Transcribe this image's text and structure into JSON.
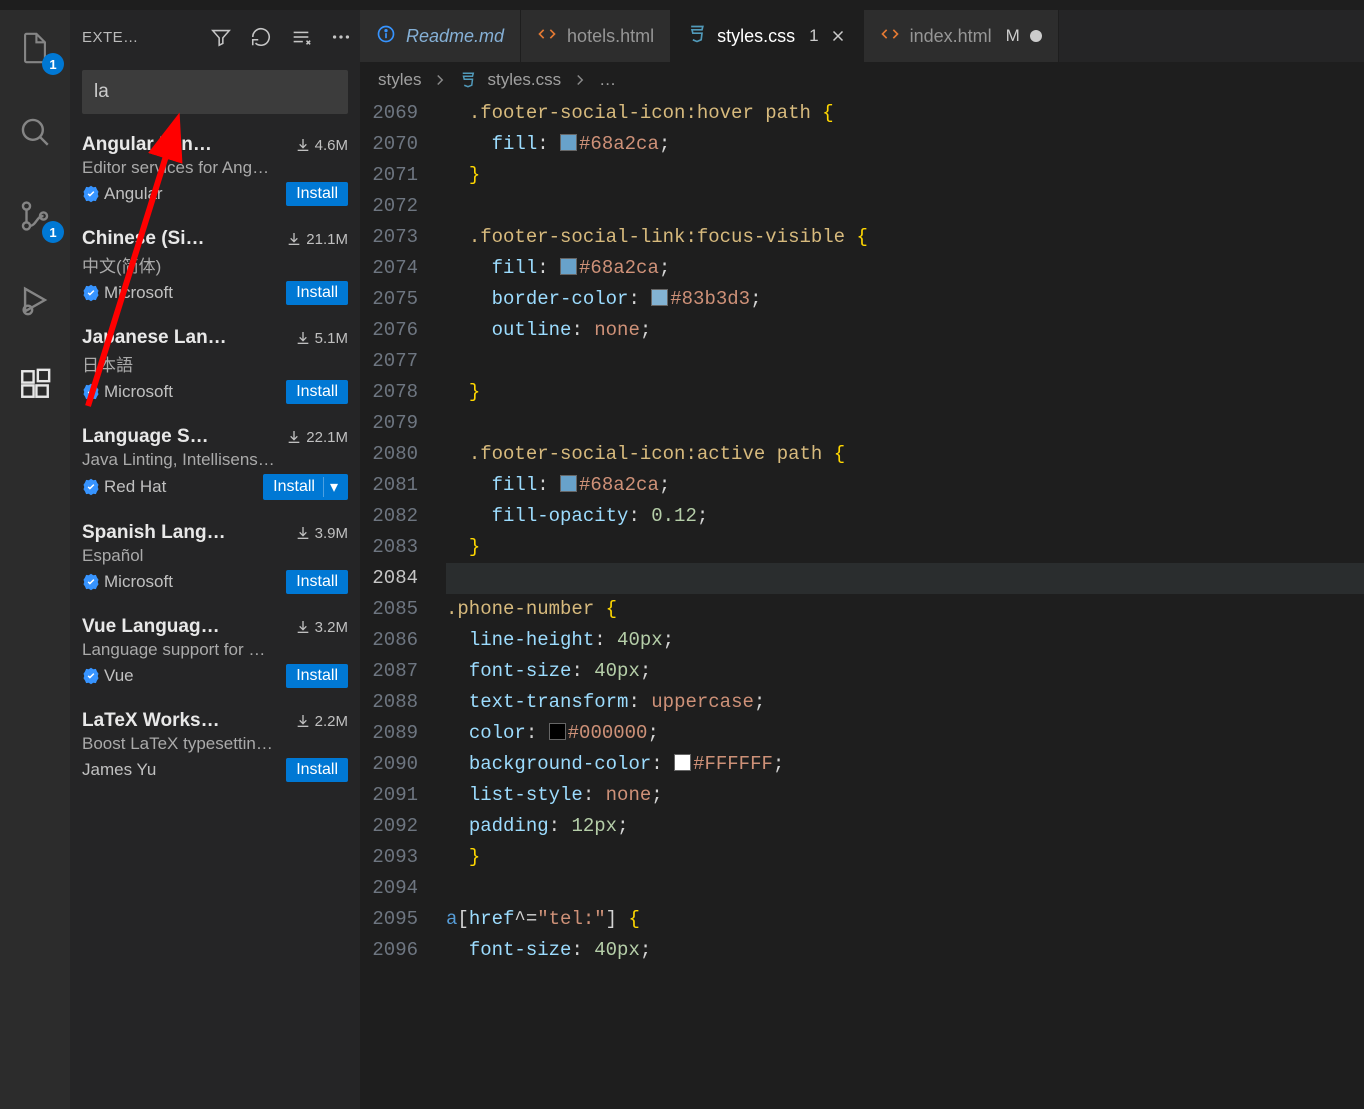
{
  "activity": {
    "explorerBadge": "1",
    "scmBadge": "1"
  },
  "sidebar": {
    "title": "EXTE…",
    "searchValue": "la",
    "items": [
      {
        "name": "Angular Lan…",
        "downloads": "4.6M",
        "desc": "Editor services for Ang…",
        "publisher": "Angular",
        "install": "Install",
        "verified": true,
        "hasDropdown": false
      },
      {
        "name": "Chinese (Si…",
        "downloads": "21.1M",
        "desc": "中文(简体)",
        "publisher": "Microsoft",
        "install": "Install",
        "verified": true,
        "hasDropdown": false
      },
      {
        "name": "Japanese Lan…",
        "downloads": "5.1M",
        "desc": "日本語",
        "publisher": "Microsoft",
        "install": "Install",
        "verified": true,
        "hasDropdown": false
      },
      {
        "name": "Language S…",
        "downloads": "22.1M",
        "desc": "Java Linting, Intellisens…",
        "publisher": "Red Hat",
        "install": "Install",
        "verified": true,
        "hasDropdown": true
      },
      {
        "name": "Spanish Lang…",
        "downloads": "3.9M",
        "desc": "Español",
        "publisher": "Microsoft",
        "install": "Install",
        "verified": true,
        "hasDropdown": false
      },
      {
        "name": "Vue Languag…",
        "downloads": "3.2M",
        "desc": "Language support for …",
        "publisher": "Vue",
        "install": "Install",
        "verified": true,
        "hasDropdown": false
      },
      {
        "name": "LaTeX Works…",
        "downloads": "2.2M",
        "desc": "Boost LaTeX typesettin…",
        "publisher": "James Yu",
        "install": "Install",
        "verified": false,
        "hasDropdown": false
      }
    ]
  },
  "tabs": [
    {
      "icon": "info",
      "filename": "Readme.md",
      "preview": true,
      "active": false,
      "status": "",
      "closable": false
    },
    {
      "icon": "html",
      "filename": "hotels.html",
      "preview": false,
      "active": false,
      "status": "",
      "closable": false
    },
    {
      "icon": "css",
      "filename": "styles.css",
      "preview": false,
      "active": true,
      "status": "1",
      "closable": true
    },
    {
      "icon": "html",
      "filename": "index.html",
      "preview": false,
      "active": false,
      "status": "M",
      "closable": false,
      "dot": true
    }
  ],
  "breadcrumb": {
    "folder": "styles",
    "file": "styles.css",
    "more": "…"
  },
  "code": {
    "currentLine": 2084,
    "lines": [
      {
        "n": 2069,
        "html": "  <span class='tok-selector'>.footer-social-icon</span><span class='tok-pseudo'>:hover</span> <span class='tok-selector'>path</span> <span class='tok-brace'>{</span>"
      },
      {
        "n": 2070,
        "html": "    <span class='tok-prop'>fill</span><span class='tok-punc'>:</span> <span class='swatch' style='background:#68a2ca'></span><span class='tok-val'>#68a2ca</span><span class='tok-punc'>;</span>"
      },
      {
        "n": 2071,
        "html": "  <span class='tok-brace'>}</span>"
      },
      {
        "n": 2072,
        "html": ""
      },
      {
        "n": 2073,
        "html": "  <span class='tok-selector'>.footer-social-link</span><span class='tok-pseudo'>:focus-visible</span> <span class='tok-brace'>{</span>"
      },
      {
        "n": 2074,
        "html": "    <span class='tok-prop'>fill</span><span class='tok-punc'>:</span> <span class='swatch' style='background:#68a2ca'></span><span class='tok-val'>#68a2ca</span><span class='tok-punc'>;</span>"
      },
      {
        "n": 2075,
        "html": "    <span class='tok-prop'>border-color</span><span class='tok-punc'>:</span> <span class='swatch' style='background:#83b3d3'></span><span class='tok-val'>#83b3d3</span><span class='tok-punc'>;</span>"
      },
      {
        "n": 2076,
        "html": "    <span class='tok-prop'>outline</span><span class='tok-punc'>:</span> <span class='tok-val'>none</span><span class='tok-punc'>;</span>"
      },
      {
        "n": 2077,
        "html": ""
      },
      {
        "n": 2078,
        "html": "  <span class='tok-brace'>}</span>"
      },
      {
        "n": 2079,
        "html": ""
      },
      {
        "n": 2080,
        "html": "  <span class='tok-selector'>.footer-social-icon</span><span class='tok-pseudo'>:active</span> <span class='tok-selector'>path</span> <span class='tok-brace'>{</span>"
      },
      {
        "n": 2081,
        "html": "    <span class='tok-prop'>fill</span><span class='tok-punc'>:</span> <span class='swatch' style='background:#68a2ca'></span><span class='tok-val'>#68a2ca</span><span class='tok-punc'>;</span>"
      },
      {
        "n": 2082,
        "html": "    <span class='tok-prop'>fill-opacity</span><span class='tok-punc'>:</span> <span class='tok-num'>0.12</span><span class='tok-punc'>;</span>"
      },
      {
        "n": 2083,
        "html": "  <span class='tok-brace'>}</span>"
      },
      {
        "n": 2084,
        "html": ""
      },
      {
        "n": 2085,
        "html": "<span class='tok-selector'>.phone-number</span> <span class='tok-brace'>{</span>"
      },
      {
        "n": 2086,
        "html": "  <span class='tok-prop'>line-height</span><span class='tok-punc'>:</span> <span class='tok-num'>40px</span><span class='tok-punc'>;</span>"
      },
      {
        "n": 2087,
        "html": "  <span class='tok-prop'>font-size</span><span class='tok-punc'>:</span> <span class='tok-num'>40px</span><span class='tok-punc'>;</span>"
      },
      {
        "n": 2088,
        "html": "  <span class='tok-prop'>text-transform</span><span class='tok-punc'>:</span> <span class='tok-val'>uppercase</span><span class='tok-punc'>;</span>"
      },
      {
        "n": 2089,
        "html": "  <span class='tok-prop'>color</span><span class='tok-punc'>:</span> <span class='swatch' style='background:#000000'></span><span class='tok-val'>#000000</span><span class='tok-punc'>;</span>"
      },
      {
        "n": 2090,
        "html": "  <span class='tok-prop'>background-color</span><span class='tok-punc'>:</span> <span class='swatch' style='background:#FFFFFF'></span><span class='tok-val'>#FFFFFF</span><span class='tok-punc'>;</span>"
      },
      {
        "n": 2091,
        "html": "  <span class='tok-prop'>list-style</span><span class='tok-punc'>:</span> <span class='tok-val'>none</span><span class='tok-punc'>;</span>"
      },
      {
        "n": 2092,
        "html": "  <span class='tok-prop'>padding</span><span class='tok-punc'>:</span> <span class='tok-num'>12px</span><span class='tok-punc'>;</span>"
      },
      {
        "n": 2093,
        "html": "  <span class='tok-brace'>}</span>"
      },
      {
        "n": 2094,
        "html": ""
      },
      {
        "n": 2095,
        "html": "<span class='tok-tag'>a</span><span class='tok-punc'>[</span><span class='tok-attr'>href</span><span class='tok-punc'>^=</span><span class='tok-str'>\"tel:\"</span><span class='tok-punc'>]</span> <span class='tok-brace'>{</span>"
      },
      {
        "n": 2096,
        "html": "  <span class='tok-prop'>font-size</span><span class='tok-punc'>:</span> <span class='tok-num'>40px</span><span class='tok-punc'>;</span>"
      }
    ]
  }
}
